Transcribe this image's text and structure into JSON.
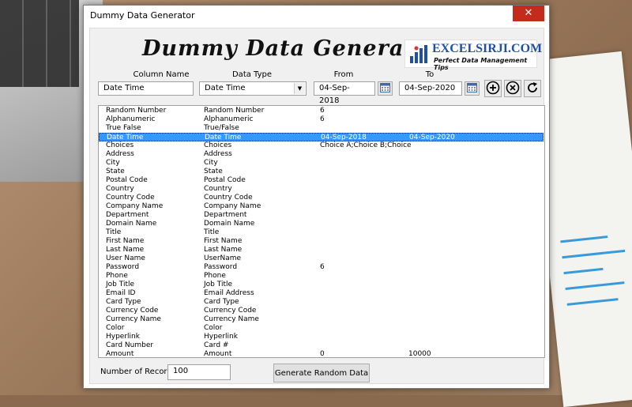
{
  "window": {
    "title": "Dummy Data Generator",
    "close_glyph": "✕"
  },
  "app": {
    "heading": "Dummy Data Generator"
  },
  "logo": {
    "main": "EXCELSIRJI.COM",
    "sub": "Perfect Data Management Tips"
  },
  "labels": {
    "column_name": "Column Name",
    "data_type": "Data Type",
    "from": "From",
    "to": "To"
  },
  "inputs": {
    "column_name": "Date Time",
    "data_type": "Date Time",
    "from": "04-Sep-2018",
    "to": "04-Sep-2020"
  },
  "colors": {
    "selection": "#3399ff",
    "logo_blue": "#1f4fa8",
    "close_red": "#c42b1c"
  },
  "rows": [
    [
      "Random Number",
      "Random Number",
      "6",
      ""
    ],
    [
      "Alphanumeric",
      "Alphanumeric",
      "6",
      ""
    ],
    [
      "True False",
      "True/False",
      "",
      ""
    ],
    [
      "Date Time",
      "Date Time",
      "04-Sep-2018",
      "04-Sep-2020"
    ],
    [
      "Choices",
      "Choices",
      "Choice A;Choice B;Choice",
      ""
    ],
    [
      "Address",
      "Address",
      "",
      ""
    ],
    [
      "City",
      "City",
      "",
      ""
    ],
    [
      "State",
      "State",
      "",
      ""
    ],
    [
      "Postal Code",
      "Postal Code",
      "",
      ""
    ],
    [
      "Country",
      "Country",
      "",
      ""
    ],
    [
      "Country Code",
      "Country Code",
      "",
      ""
    ],
    [
      "Company Name",
      "Company Name",
      "",
      ""
    ],
    [
      "Department",
      "Department",
      "",
      ""
    ],
    [
      "Domain Name",
      "Domain Name",
      "",
      ""
    ],
    [
      "Title",
      "Title",
      "",
      ""
    ],
    [
      "First Name",
      "First Name",
      "",
      ""
    ],
    [
      "Last Name",
      "Last Name",
      "",
      ""
    ],
    [
      "User Name",
      "UserName",
      "",
      ""
    ],
    [
      "Password",
      "Password",
      "6",
      ""
    ],
    [
      "Phone",
      "Phone",
      "",
      ""
    ],
    [
      "Job Title",
      "Job Title",
      "",
      ""
    ],
    [
      "Email ID",
      "Email Address",
      "",
      ""
    ],
    [
      "Card Type",
      "Card Type",
      "",
      ""
    ],
    [
      "Currency Code",
      "Currency Code",
      "",
      ""
    ],
    [
      "Currency Name",
      "Currency Name",
      "",
      ""
    ],
    [
      "Color",
      "Color",
      "",
      ""
    ],
    [
      "Hyperlink",
      "Hyperlink",
      "",
      ""
    ],
    [
      "Card Number",
      "Card #",
      "",
      ""
    ],
    [
      "Amount",
      "Amount",
      "0",
      "10000"
    ]
  ],
  "selected_row": 3,
  "records": {
    "label": "Number of Records:",
    "value": "100"
  },
  "buttons": {
    "generate": "Generate Random Data"
  }
}
